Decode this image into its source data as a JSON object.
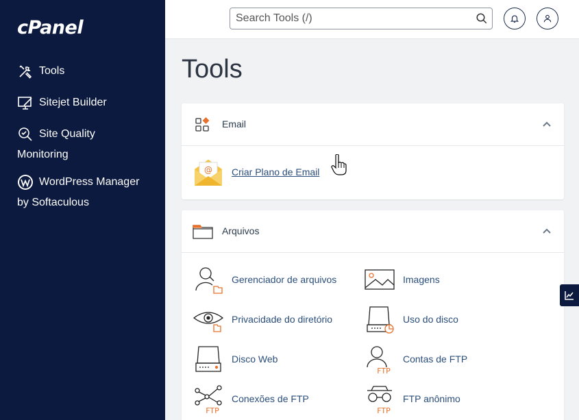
{
  "brand": {
    "logo_text": "cPanel"
  },
  "sidebar": {
    "items": [
      {
        "line1": "Tools",
        "line2": "",
        "icon": "tools-icon"
      },
      {
        "line1": "Sitejet Builder",
        "line2": "",
        "icon": "monitor-brush-icon"
      },
      {
        "line1": "Site Quality",
        "line2": "Monitoring",
        "icon": "magnifier-check-icon"
      },
      {
        "line1": "WordPress Manager",
        "line2": "by Softaculous",
        "icon": "wordpress-icon"
      }
    ]
  },
  "topbar": {
    "search_placeholder": "Search Tools (/)"
  },
  "page": {
    "title": "Tools"
  },
  "email_panel": {
    "title": "Email",
    "tools": [
      {
        "label": "Criar Plano de Email"
      }
    ]
  },
  "files_panel": {
    "title": "Arquivos",
    "tools": [
      {
        "label": "Gerenciador de arquivos"
      },
      {
        "label": "Imagens"
      },
      {
        "label": "Privacidade do diretório"
      },
      {
        "label": "Uso do disco"
      },
      {
        "label": "Disco Web"
      },
      {
        "label": "Contas de FTP"
      },
      {
        "label": "Conexões de FTP"
      },
      {
        "label": "FTP anônimo"
      }
    ],
    "ftp_badge": "FTP"
  },
  "colors": {
    "sidebar_bg": "#0b1a3e",
    "accent_orange": "#e8702a",
    "link": "#2a4e7b"
  }
}
